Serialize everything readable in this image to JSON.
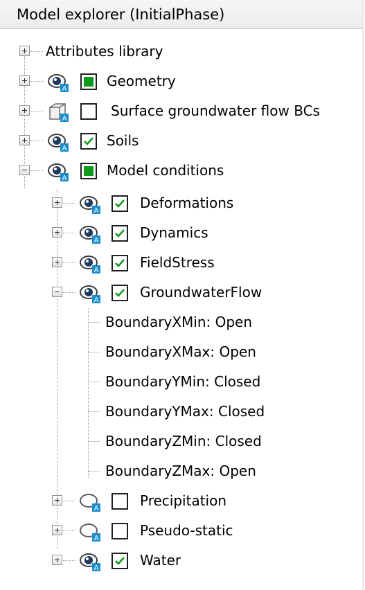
{
  "panel": {
    "title": "Model explorer (InitialPhase)"
  },
  "tree": {
    "items": [
      {
        "label": "Attributes library",
        "expanded": false,
        "checkbox": "none",
        "icon": "none"
      },
      {
        "label": "Geometry",
        "expanded": false,
        "checkbox": "partial",
        "icon": "eye-icon"
      },
      {
        "label": "Surface groundwater flow BCs",
        "expanded": false,
        "checkbox": "unchecked",
        "icon": "surface-boundary-icon"
      },
      {
        "label": "Soils",
        "expanded": false,
        "checkbox": "checked",
        "icon": "eye-icon"
      },
      {
        "label": "Model conditions",
        "expanded": true,
        "checkbox": "partial",
        "icon": "eye-icon"
      },
      {
        "label": "Deformations",
        "expanded": false,
        "checkbox": "checked",
        "icon": "eye-icon"
      },
      {
        "label": "Dynamics",
        "expanded": false,
        "checkbox": "checked",
        "icon": "eye-icon"
      },
      {
        "label": "FieldStress",
        "expanded": false,
        "checkbox": "checked",
        "icon": "eye-icon"
      },
      {
        "label": "GroundwaterFlow",
        "expanded": true,
        "checkbox": "checked",
        "icon": "eye-icon"
      },
      {
        "label": "BoundaryXMin: Open"
      },
      {
        "label": "BoundaryXMax: Open"
      },
      {
        "label": "BoundaryYMin: Closed"
      },
      {
        "label": "BoundaryYMax: Closed"
      },
      {
        "label": "BoundaryZMin: Closed"
      },
      {
        "label": "BoundaryZMax: Open"
      },
      {
        "label": "Precipitation",
        "expanded": false,
        "checkbox": "unchecked",
        "icon": "eye-closed-icon"
      },
      {
        "label": "Pseudo-static",
        "expanded": false,
        "checkbox": "unchecked",
        "icon": "eye-closed-icon"
      },
      {
        "label": "Water",
        "expanded": false,
        "checkbox": "checked",
        "icon": "eye-icon"
      }
    ]
  },
  "colors": {
    "check": "#0e9a1a",
    "eye_blue": "#1b8ecf"
  }
}
